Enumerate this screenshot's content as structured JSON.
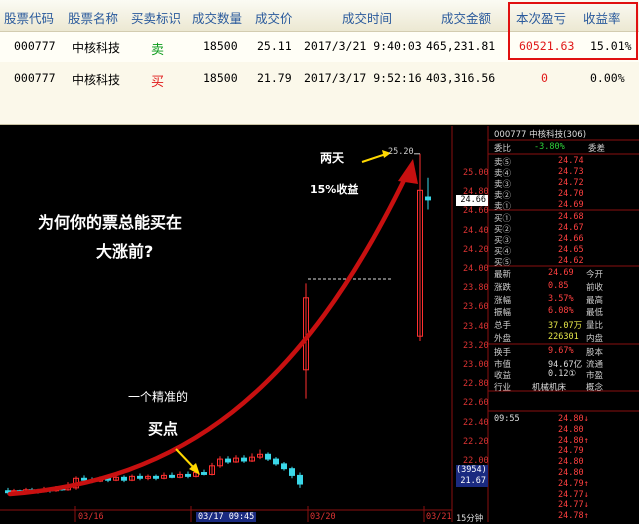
{
  "table": {
    "headers": [
      "股票代码",
      "股票名称",
      "买卖标识",
      "成交数量",
      "成交价",
      "成交时间",
      "成交金额",
      "本次盈亏",
      "收益率"
    ],
    "rows": [
      {
        "code": "000777",
        "name": "中核科技",
        "side": "卖",
        "qty": "18500",
        "price": "25.11",
        "time": "2017/3/21 9:40:03",
        "amount": "465,231.81",
        "pnl": "60521.63",
        "yield": "15.01%"
      },
      {
        "code": "000777",
        "name": "中核科技",
        "side": "买",
        "qty": "18500",
        "price": "21.79",
        "time": "2017/3/17 9:52:16",
        "amount": "403,316.56",
        "pnl": "0",
        "yield": "0.00%"
      }
    ]
  },
  "chart": {
    "annotations": {
      "question_line1": "为何你的票总能买在",
      "question_line2": "大涨前?",
      "two_days": "两天",
      "gain": "15%收益",
      "precise": "一个精准的",
      "buy_point": "买点"
    },
    "peak_label": "25.20",
    "price_ticks": [
      "25.00",
      "24.80",
      "24.60",
      "24.40",
      "24.20",
      "24.00",
      "23.80",
      "23.60",
      "23.40",
      "23.20",
      "23.00",
      "22.80",
      "22.60",
      "22.40",
      "22.20",
      "22.00",
      "21.80",
      "21.67"
    ],
    "current_price_tag": "24.66",
    "bottom_tag": "(3954)",
    "date_labels": [
      "03/16",
      "03/17 09:45",
      "03/20",
      "03/21"
    ],
    "period_label": "15分钟"
  },
  "quote_panel": {
    "title": "000777 中核科技(306)",
    "ratio": {
      "label": "委比",
      "value": "-3.80%",
      "label2": "委差"
    },
    "asks": [
      {
        "label": "卖⑤",
        "price": "24.74"
      },
      {
        "label": "卖④",
        "price": "24.73"
      },
      {
        "label": "卖③",
        "price": "24.72"
      },
      {
        "label": "卖②",
        "price": "24.70"
      },
      {
        "label": "卖①",
        "price": "24.69"
      }
    ],
    "bids": [
      {
        "label": "买①",
        "price": "24.68"
      },
      {
        "label": "买②",
        "price": "24.67"
      },
      {
        "label": "买③",
        "price": "24.66"
      },
      {
        "label": "买④",
        "price": "24.65"
      },
      {
        "label": "买⑤",
        "price": "24.62"
      }
    ],
    "stats": [
      {
        "l1": "最新",
        "v1": "24.69",
        "l2": "今开"
      },
      {
        "l1": "涨跌",
        "v1": "0.85",
        "l2": "前收"
      },
      {
        "l1": "涨幅",
        "v1": "3.57%",
        "l2": "最高"
      },
      {
        "l1": "振幅",
        "v1": "6.08%",
        "l2": "最低"
      },
      {
        "l1": "总手",
        "v1": "37.07万",
        "l2": "量比"
      },
      {
        "l1": "外盘",
        "v1": "226301",
        "l2": "内盘"
      }
    ],
    "fund": [
      {
        "l1": "换手",
        "v1": "9.67%",
        "l2": "股本"
      },
      {
        "l1": "市值",
        "v1": "94.67亿",
        "l2": "流通"
      },
      {
        "l1": "收益",
        "v1": "0.12①",
        "l2": "市盈"
      },
      {
        "l1": "行业",
        "v1": "机械机床",
        "l2": "概念"
      }
    ],
    "ticks": [
      {
        "time": "09:55",
        "price": "24.80↓"
      },
      {
        "time": "",
        "price": "24.80"
      },
      {
        "time": "",
        "price": "24.80↑"
      },
      {
        "time": "",
        "price": "24.79"
      },
      {
        "time": "",
        "price": "24.80"
      },
      {
        "time": "",
        "price": "24.80"
      },
      {
        "time": "",
        "price": "24.79↑"
      },
      {
        "time": "",
        "price": "24.77↓"
      },
      {
        "time": "",
        "price": "24.77↓"
      },
      {
        "time": "",
        "price": "24.78↑"
      }
    ]
  },
  "colors": {
    "up": "#ff3030",
    "down": "#2fd13a",
    "accent_box": "#e01010",
    "arrow": "#c81010",
    "header_text": "#2a5a9c"
  }
}
